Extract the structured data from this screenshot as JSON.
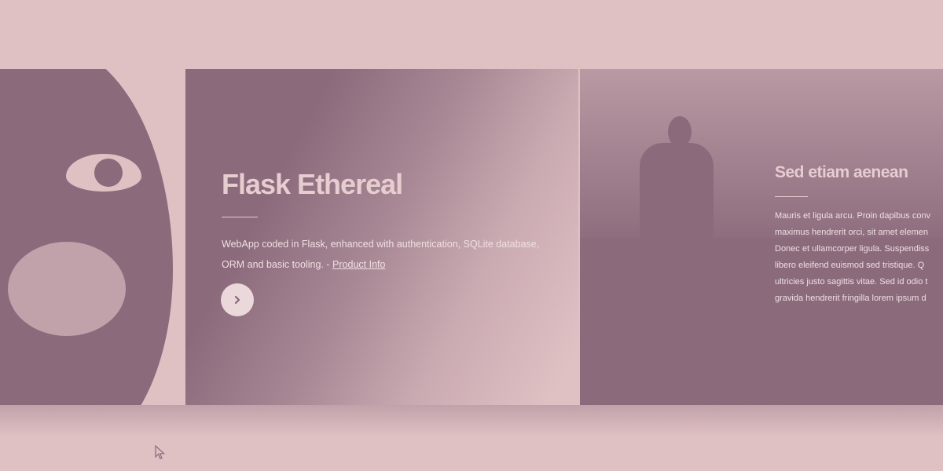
{
  "slide_left": {
    "title": "Flask Ethereal",
    "description": "WebApp coded in Flask, enhanced with authentication, SQLite database, ORM and basic tooling. - ",
    "link_label": "Product Info"
  },
  "slide_right": {
    "title": "Sed etiam aenean",
    "lines": [
      "Mauris et ligula arcu. Proin dapibus conv",
      "maximus hendrerit orci, sit amet elemen",
      "Donec et ullamcorper ligula. Suspendiss",
      "libero eleifend euismod sed tristique. Q",
      "ultricies justo sagittis vitae. Sed id odio t",
      "gravida hendrerit fringilla lorem ipsum d"
    ]
  },
  "icons": {
    "next": "chevron-right-icon",
    "cursor": "mouse-pointer-icon"
  },
  "colors": {
    "background": "#dfc0c3",
    "panel": "#8b6a7c",
    "text": "#efe0e2",
    "button": "#ead8da"
  }
}
